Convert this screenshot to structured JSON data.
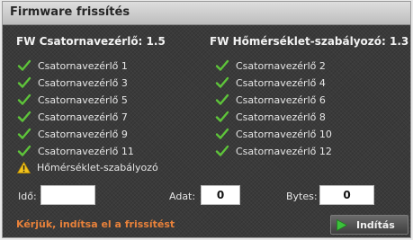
{
  "window": {
    "title": "Firmware frissítés"
  },
  "left_column": {
    "title": "FW Csatornavezérlő: 1.5",
    "items": [
      {
        "label": "Csatornavezérlő 1",
        "status": "ok"
      },
      {
        "label": "Csatornavezérlő 3",
        "status": "ok"
      },
      {
        "label": "Csatornavezérlő 5",
        "status": "ok"
      },
      {
        "label": "Csatornavezérlő 7",
        "status": "ok"
      },
      {
        "label": "Csatornavezérlő 9",
        "status": "ok"
      },
      {
        "label": "Csatornavezérlő 11",
        "status": "ok"
      }
    ]
  },
  "right_column": {
    "title": "FW Hőmérséklet-szabályozó: 1.3",
    "items": [
      {
        "label": "Csatornavezérlő 2",
        "status": "ok"
      },
      {
        "label": "Csatornavezérlő 4",
        "status": "ok"
      },
      {
        "label": "Csatornavezérlő 6",
        "status": "ok"
      },
      {
        "label": "Csatornavezérlő 8",
        "status": "ok"
      },
      {
        "label": "Csatornavezérlő 10",
        "status": "ok"
      },
      {
        "label": "Csatornavezérlő 12",
        "status": "ok"
      }
    ]
  },
  "warning": {
    "label": "Hőmérséklet-szabályozó",
    "icon": "warning-icon"
  },
  "fields": {
    "time_label": "Idő:",
    "time_value": "",
    "data_label": "Adat:",
    "data_value": "0",
    "bytes_label": "Bytes:",
    "bytes_value": "0"
  },
  "message": "Kérjük, indítsa el a frissítést",
  "start_button": {
    "label": "Indítás",
    "icon": "play-icon"
  },
  "colors": {
    "check": "#5ec43a",
    "warning": "#f2c21b",
    "message": "#e8813a",
    "play": "#3cc13c"
  }
}
